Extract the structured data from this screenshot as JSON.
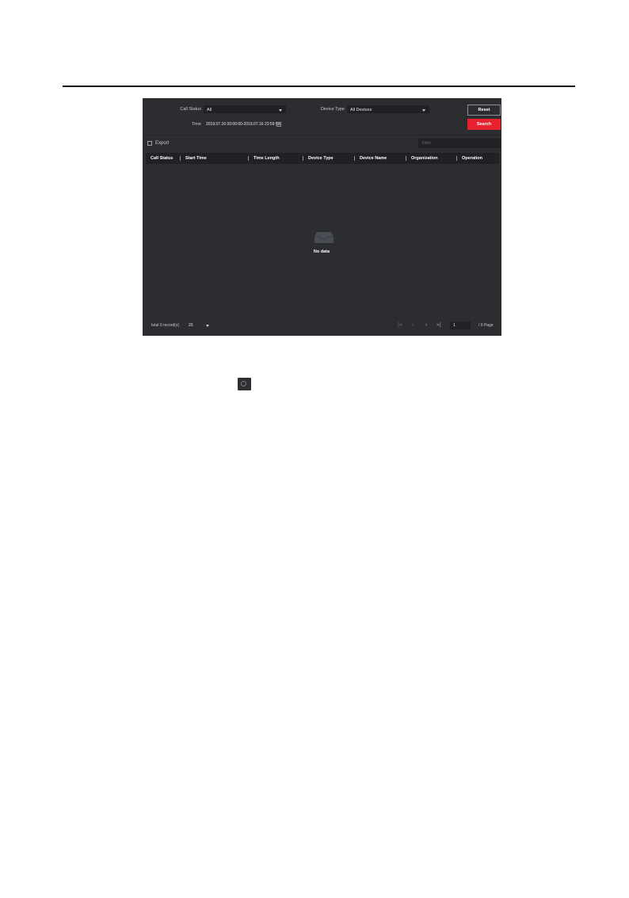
{
  "colors": {
    "panel_bg": "#2b2d31",
    "input_bg": "#1f2124",
    "accent_red": "#e8212e",
    "text": "#c9cbcf"
  },
  "filters": {
    "call_status_label": "Call Status",
    "call_status_value": "All",
    "device_type_label": "Device Type",
    "device_type_value": "All Devices",
    "time_label": "Time",
    "time_value": "2019.07.16 00:00:00-2019.07.16 23:59:59",
    "reset_label": "Reset",
    "search_label": "Search"
  },
  "toolbar": {
    "export_label": "Export",
    "filter_placeholder": "Filter"
  },
  "table": {
    "columns": [
      "Call Status",
      "Start Time",
      "Time Length",
      "Device Type",
      "Device Name",
      "Organization",
      "Operation"
    ],
    "empty_text": "No data"
  },
  "pagination": {
    "total_text": "total 0 record(s)",
    "page_size": "20",
    "current_page": "1",
    "total_pages_text": "/ 0 Page"
  },
  "icons": [
    "calendar-icon",
    "export-icon",
    "empty-box-icon",
    "first-page-icon",
    "prev-page-icon",
    "next-page-icon",
    "last-page-icon",
    "refresh-icon"
  ]
}
